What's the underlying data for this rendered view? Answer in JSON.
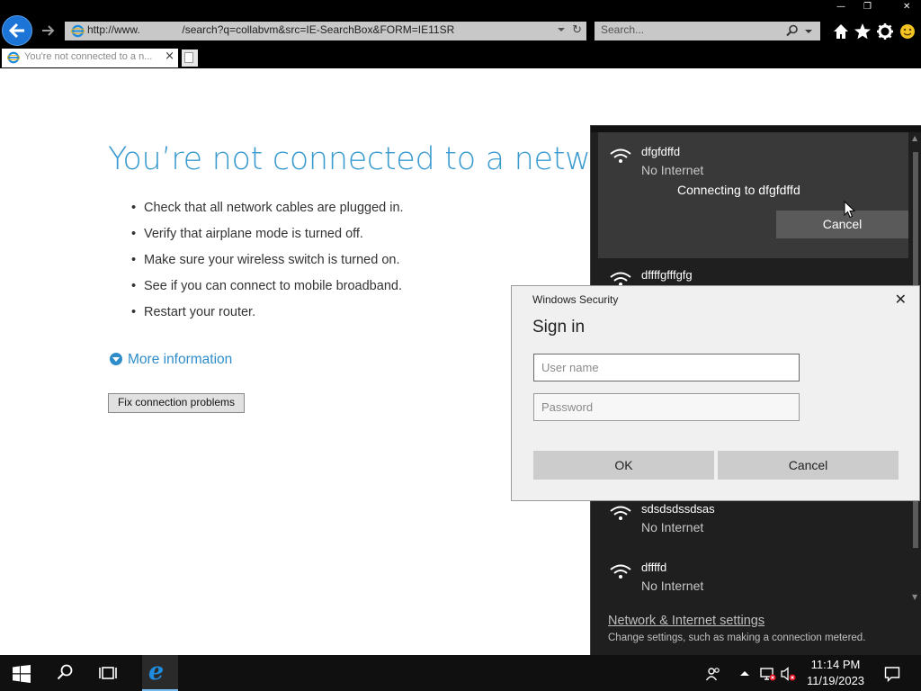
{
  "browser": {
    "address_url": "http://www.              /search?q=collabvm&src=IE-SearchBox&FORM=IE11SR",
    "search_placeholder": "Search...",
    "tab_title": "You're not connected to a n...",
    "tab_close": "×"
  },
  "page": {
    "heading": "You’re not connected to a network",
    "tips": [
      "Check that all network cables are plugged in.",
      "Verify that airplane mode is turned off.",
      "Make sure your wireless switch is turned on.",
      "See if you can connect to mobile broadband.",
      "Restart your router."
    ],
    "more_info": "More information",
    "fix_button": "Fix connection problems"
  },
  "flyout": {
    "networks": [
      {
        "name": "dfgfdffd",
        "status": "No Internet"
      },
      {
        "name": "dffffgfffgfg",
        "status": ""
      },
      {
        "name": "sdsdsdssdsas",
        "status": "No Internet"
      },
      {
        "name": "dffffd",
        "status": "No Internet"
      }
    ],
    "connecting_text": "Connecting to dfgfdffd",
    "cancel_label": "Cancel",
    "settings_link": "Network & Internet settings",
    "settings_desc": "Change settings, such as making a connection metered."
  },
  "dialog": {
    "caption": "Windows Security",
    "title": "Sign in",
    "username_placeholder": "User name",
    "password_placeholder": "Password",
    "ok_label": "OK",
    "cancel_label": "Cancel",
    "close_glyph": "✕"
  },
  "taskbar": {
    "time": "11:14 PM",
    "date": "11/19/2023"
  },
  "colors": {
    "accent_blue": "#3a9bd0",
    "flyout_bg": "#1f1f1f",
    "dialog_bg": "#f0f0f0"
  }
}
